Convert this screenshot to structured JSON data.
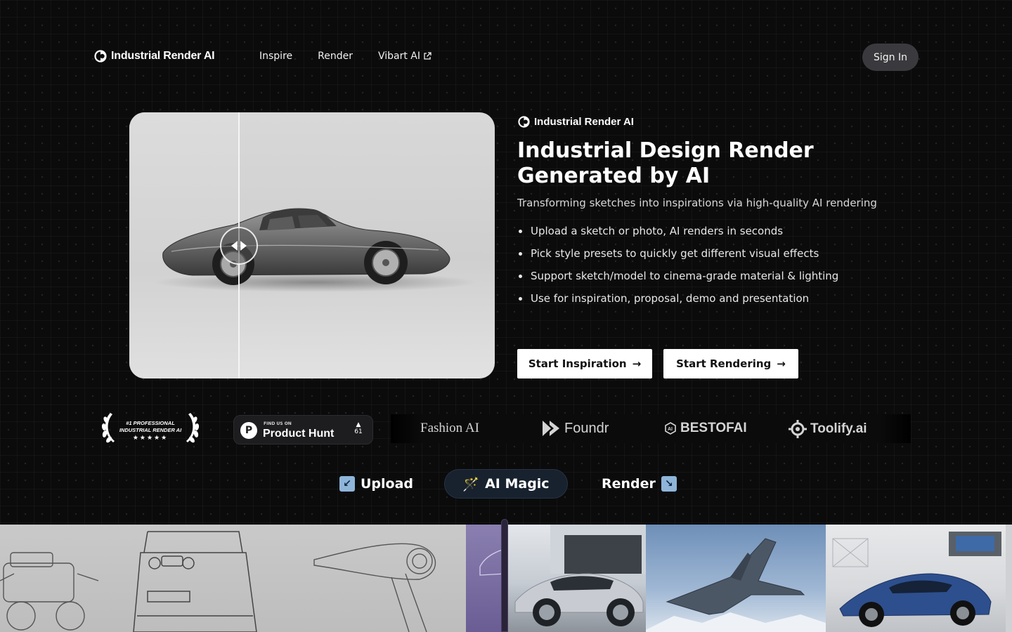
{
  "nav": {
    "logo_text": "Industrial Render AI",
    "links": [
      {
        "label": "Inspire"
      },
      {
        "label": "Render"
      },
      {
        "label": "Vibart AI",
        "external": true
      }
    ],
    "signin_label": "Sign In"
  },
  "hero": {
    "brand": "Industrial Render AI",
    "title_line1": "Industrial Design Render",
    "title_line2": "Generated by AI",
    "subtitle": "Transforming sketches into inspirations via high-quality AI rendering",
    "features": [
      "Upload a sketch or photo, AI renders in seconds",
      "Pick style presets to quickly get different visual effects",
      "Support sketch/model to cinema-grade material & lighting",
      "Use for inspiration, proposal, demo and presentation"
    ],
    "cta_primary": "Start Inspiration",
    "cta_secondary": "Start Rendering",
    "arrow": "→"
  },
  "badges": {
    "award_line1": "#1 PROFESSIONAL",
    "award_line2": "INDUSTRIAL RENDER AI",
    "award_stars": "★★★★★",
    "ph_small": "FIND US ON",
    "ph_big": "Product Hunt",
    "ph_logo": "P",
    "ph_arrow": "▲",
    "ph_votes": "61",
    "fashion": "Fashion AI",
    "foundr": "Foundr",
    "bestof": "BESTOFAI",
    "toolify": "Toolify.ai"
  },
  "steps": {
    "upload": "Upload",
    "upload_emoji": "↙",
    "magic": "AI Magic",
    "magic_emoji": "🪄",
    "render": "Render",
    "render_emoji": "↘"
  },
  "colors": {
    "background": "#0b0b0c",
    "signin_bg": "#3a3a3e",
    "magic_bg": "#18222e",
    "emoji_box": "#8fb5d9"
  }
}
